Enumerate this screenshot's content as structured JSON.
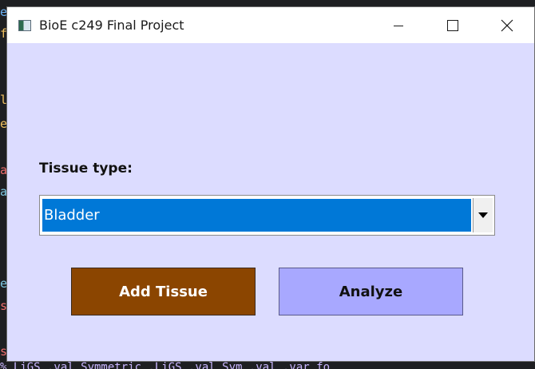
{
  "window": {
    "title": "BioE c249 Final Project",
    "background": "#dcdcff"
  },
  "controls": {
    "minimize": "minimize",
    "maximize": "maximize",
    "close": "close"
  },
  "form": {
    "tissue_label": "Tissue type:",
    "tissue_selected": "Bladder",
    "selection_color": "#0078d7"
  },
  "buttons": {
    "add_tissue": {
      "label": "Add Tissue",
      "color": "#8b4500"
    },
    "analyze": {
      "label": "Analyze",
      "color": "#a8a8ff"
    }
  },
  "background_editor": {
    "bottom_line": "% LiGS .val Symmetric .LiGS .val Sym .val .var fo"
  }
}
